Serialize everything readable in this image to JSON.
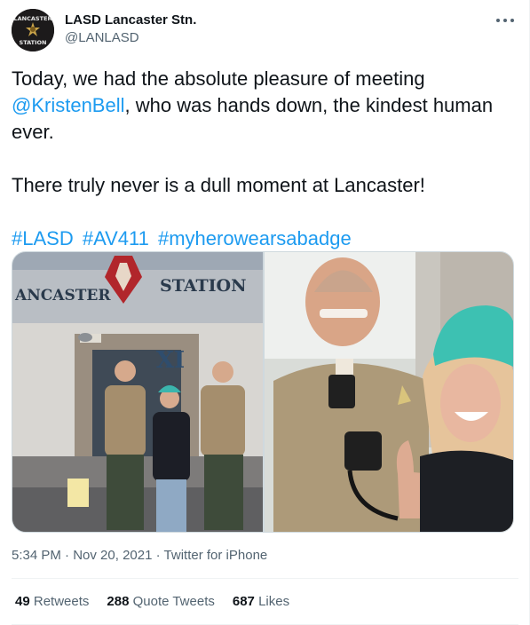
{
  "account": {
    "display_name": "LASD Lancaster Stn.",
    "handle": "@LANLASD",
    "avatar_text_top": "LANCASTER",
    "avatar_text_bottom": "STATION"
  },
  "tweet": {
    "line1_pre": "Today, we had the absolute pleasure of meeting ",
    "mention": "@KristenBell",
    "line1_post": ", who was hands down, the kindest human ever.",
    "line2": "There truly never is a dull moment at Lancaster!",
    "hashtags": [
      "#LASD",
      "#AV411",
      "#myherowearsabadge"
    ]
  },
  "photo_left": {
    "sign_left": "ANCASTER",
    "sign_right": "STATION",
    "roman": "XI"
  },
  "meta": {
    "time": "5:34 PM",
    "separator": "·",
    "date": "Nov 20, 2021",
    "source": "Twitter for iPhone"
  },
  "stats": {
    "retweets_count": "49",
    "retweets_label": "Retweets",
    "quotes_count": "288",
    "quotes_label": "Quote Tweets",
    "likes_count": "687",
    "likes_label": "Likes"
  },
  "colors": {
    "link": "#1d9bf0",
    "secondary_text": "#536471",
    "primary_text": "#0f1419"
  },
  "icons": {
    "more": "more-horizontal-icon"
  }
}
